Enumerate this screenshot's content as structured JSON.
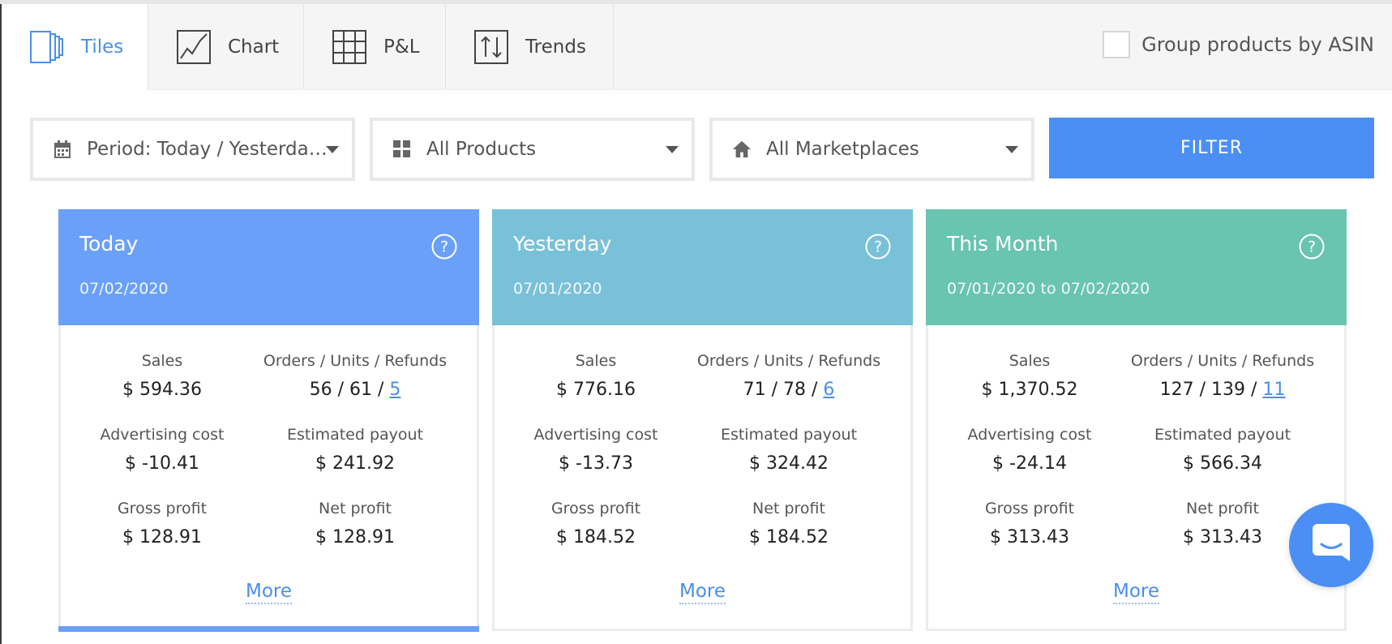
{
  "tabs": [
    {
      "label": "Tiles",
      "icon": "tiles-icon",
      "active": true
    },
    {
      "label": "Chart",
      "icon": "line-chart-icon",
      "active": false
    },
    {
      "label": "P&L",
      "icon": "grid-table-icon",
      "active": false
    },
    {
      "label": "Trends",
      "icon": "up-down-arrows-icon",
      "active": false
    }
  ],
  "group_toggle": {
    "label": "Group products by ASIN",
    "checked": false
  },
  "filters": {
    "period": "Period: Today / Yesterday ...",
    "products": "All Products",
    "marketplaces": "All Marketplaces",
    "button": "FILTER"
  },
  "tiles": [
    {
      "title": "Today",
      "date": "07/02/2020",
      "header_color": "#6aa0f8",
      "sales_label": "Sales",
      "sales": "$ 594.36",
      "orders_label": "Orders / Units / Refunds",
      "orders_units": "56 / 61 /",
      "refunds": "5",
      "ad_label": "Advertising cost",
      "ad_cost": "$ -10.41",
      "payout_label": "Estimated payout",
      "payout": "$ 241.92",
      "gross_label": "Gross profit",
      "gross": "$ 128.91",
      "net_label": "Net profit",
      "net": "$ 128.91",
      "more": "More"
    },
    {
      "title": "Yesterday",
      "date": "07/01/2020",
      "header_color": "#79c1d8",
      "sales_label": "Sales",
      "sales": "$ 776.16",
      "orders_label": "Orders / Units / Refunds",
      "orders_units": "71 / 78 /",
      "refunds": "6",
      "ad_label": "Advertising cost",
      "ad_cost": "$ -13.73",
      "payout_label": "Estimated payout",
      "payout": "$ 324.42",
      "gross_label": "Gross profit",
      "gross": "$ 184.52",
      "net_label": "Net profit",
      "net": "$ 184.52",
      "more": "More"
    },
    {
      "title": "This Month",
      "date": "07/01/2020 to 07/02/2020",
      "header_color": "#69c4b0",
      "sales_label": "Sales",
      "sales": "$ 1,370.52",
      "orders_label": "Orders / Units / Refunds",
      "orders_units": "127 / 139 /",
      "refunds": "11",
      "ad_label": "Advertising cost",
      "ad_cost": "$ -24.14",
      "payout_label": "Estimated payout",
      "payout": "$ 566.34",
      "gross_label": "Gross profit",
      "gross": "$ 313.43",
      "net_label": "Net profit",
      "net": "$ 313.43",
      "more": "More"
    }
  ],
  "colors": {
    "accent": "#4b8ff5",
    "link": "#4a8fe8"
  }
}
